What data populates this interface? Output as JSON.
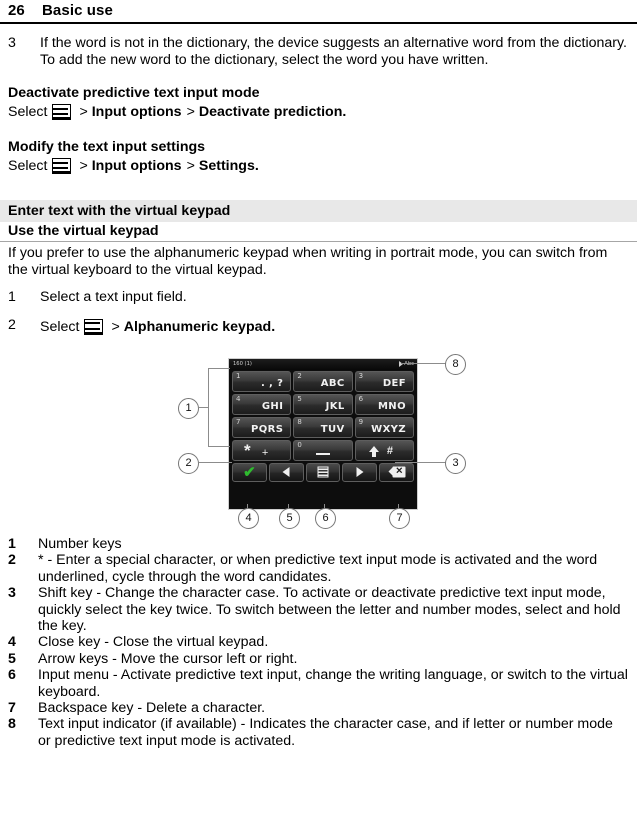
{
  "header": {
    "page_number": "26",
    "title": "Basic use"
  },
  "steps_top": [
    {
      "num": "3",
      "text": "If the word is not in the dictionary, the device suggests an alternative word from the dictionary. To add the new word to the dictionary, select the word you have written."
    }
  ],
  "sections": [
    {
      "heading": "Deactivate predictive text input mode",
      "select_label": "Select",
      "menu_icon": "options-menu-icon",
      "gt1": ">",
      "path1": "Input options",
      "gt2": ">",
      "path2": "Deactivate prediction",
      "period": "."
    },
    {
      "heading": "Modify the text input settings",
      "select_label": "Select",
      "menu_icon": "options-menu-icon",
      "gt1": ">",
      "path1": "Input options",
      "gt2": ">",
      "path2": "Settings",
      "period": "."
    }
  ],
  "banner": "Enter text with the virtual keypad",
  "subhead": "Use the virtual keypad",
  "intro": "If you prefer to use the alphanumeric keypad when writing in portrait mode, you can switch from the virtual keyboard to the virtual keypad.",
  "steps_bottom": [
    {
      "num": "1",
      "text": "Select a text input field."
    }
  ],
  "step2": {
    "num": "2",
    "select_label": "Select",
    "menu_icon": "options-menu-icon",
    "gt": ">",
    "path": "Alphanumeric keypad",
    "period": "."
  },
  "keypad": {
    "status_left": "160 (1)",
    "status_right": "Abc",
    "signal_icon": "signal-indicator-icon",
    "rows": [
      [
        {
          "digit": "1",
          "label": ". , ?"
        },
        {
          "digit": "2",
          "label": "ABC"
        },
        {
          "digit": "3",
          "label": "DEF"
        }
      ],
      [
        {
          "digit": "4",
          "label": "GHI"
        },
        {
          "digit": "5",
          "label": "JKL"
        },
        {
          "digit": "6",
          "label": "MNO"
        }
      ],
      [
        {
          "digit": "7",
          "label": "PQRS"
        },
        {
          "digit": "8",
          "label": "TUV"
        },
        {
          "digit": "9",
          "label": "WXYZ"
        }
      ]
    ],
    "star_key": {
      "symbol": "*",
      "secondary": "+"
    },
    "zero_key": {
      "digit": "0",
      "space_icon": "space-bar-icon"
    },
    "shift_key": {
      "arrow_icon": "shift-arrow-icon",
      "secondary": "#"
    },
    "function_row": [
      {
        "name": "close-key",
        "icon": "green-check-icon"
      },
      {
        "name": "left-arrow-key",
        "icon": "arrow-left-icon"
      },
      {
        "name": "input-menu-key",
        "icon": "input-menu-icon"
      },
      {
        "name": "right-arrow-key",
        "icon": "arrow-right-icon"
      },
      {
        "name": "backspace-key",
        "icon": "backspace-icon"
      }
    ],
    "callouts": [
      "1",
      "2",
      "3",
      "4",
      "5",
      "6",
      "7",
      "8"
    ]
  },
  "legend": [
    {
      "n": "1",
      "t": "Number keys"
    },
    {
      "n": "2",
      "t": "* - Enter a special character, or when predictive text input mode is activated and the word underlined, cycle through the word candidates."
    },
    {
      "n": "3",
      "t": "Shift key - Change the character case. To activate or deactivate predictive text input mode, quickly select the key twice. To switch between the letter and number modes, select and hold the key."
    },
    {
      "n": "4",
      "t": "Close key - Close the virtual keypad."
    },
    {
      "n": "5",
      "t": "Arrow keys - Move the cursor left or right."
    },
    {
      "n": "6",
      "t": "Input menu - Activate predictive text input, change the writing language, or switch to the virtual keyboard."
    },
    {
      "n": "7",
      "t": "Backspace key - Delete a character."
    },
    {
      "n": "8",
      "t": "Text input indicator (if available) - Indicates the character case, and if letter or number mode or predictive text input mode is activated."
    }
  ],
  "colors": {
    "banner_bg": "#e8e8e8",
    "check_green": "#2fbb2f",
    "device_bg": "#0d0d0d"
  }
}
